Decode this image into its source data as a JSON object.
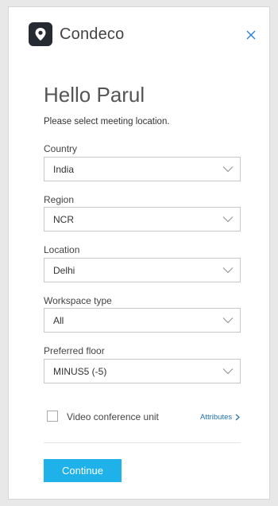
{
  "app": {
    "brand": "Condeco"
  },
  "greeting": "Hello Parul",
  "subtitle": "Please select meeting location.",
  "fields": [
    {
      "label": "Country",
      "value": "India"
    },
    {
      "label": "Region",
      "value": "NCR"
    },
    {
      "label": "Location",
      "value": "Delhi"
    },
    {
      "label": "Workspace type",
      "value": "All"
    },
    {
      "label": "Preferred floor",
      "value": "MINUS5 (-5)"
    }
  ],
  "video_conference": {
    "label": "Video conference unit",
    "checked": false
  },
  "attributes_link": "Attributes",
  "continue_label": "Continue",
  "colors": {
    "accent": "#1fb2ea",
    "logo_bg": "#262a33",
    "link": "#1e6fb0",
    "close_icon": "#2b7fd0"
  },
  "icons": {
    "logo": "location-pin-icon",
    "close": "close-icon",
    "dropdown": "chevron-down-icon",
    "link": "chevron-right-icon"
  }
}
